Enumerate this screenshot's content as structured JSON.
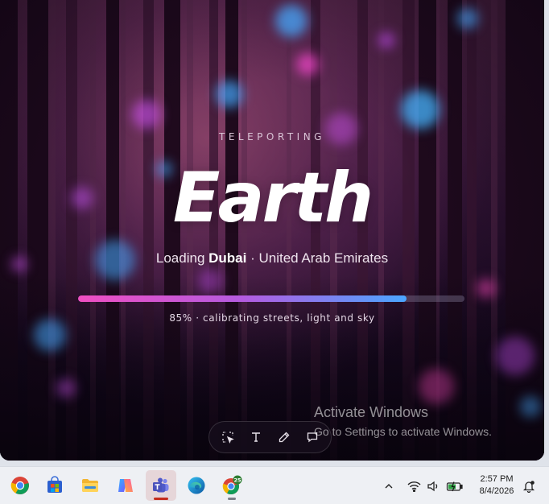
{
  "loader": {
    "eyebrow": "TELEPORTING",
    "hero_title": "Earth",
    "loading_prefix": "Loading ",
    "city": "Dubai",
    "country_suffix": " · United Arab Emirates",
    "progress_percent": 85,
    "progress_caption": "85% · calibrating streets, light and sky"
  },
  "watermark": {
    "title": "Activate Windows",
    "subtitle": "Go to Settings to activate Windows."
  },
  "annotation_toolbar": {
    "tools": [
      "selection-tool-icon",
      "text-tool-icon",
      "pen-tool-icon",
      "comment-tool-icon"
    ]
  },
  "taskbar": {
    "apps": [
      {
        "name": "chrome",
        "icon": "chrome-icon"
      },
      {
        "name": "microsoft-store",
        "icon": "store-icon"
      },
      {
        "name": "file-explorer",
        "icon": "folder-icon"
      },
      {
        "name": "copilot",
        "icon": "copilot-icon"
      },
      {
        "name": "teams",
        "icon": "teams-icon",
        "active": true
      },
      {
        "name": "edge",
        "icon": "edge-icon"
      },
      {
        "name": "chrome-profile",
        "icon": "chrome-badge-icon",
        "badge": "25"
      }
    ],
    "clock_time": "2:57 PM",
    "clock_date": "8/4/2026"
  },
  "colors": {
    "progress_start": "#ef4fc2",
    "progress_end": "#4aa6ff",
    "teams_indicator": "#c42b1c"
  }
}
